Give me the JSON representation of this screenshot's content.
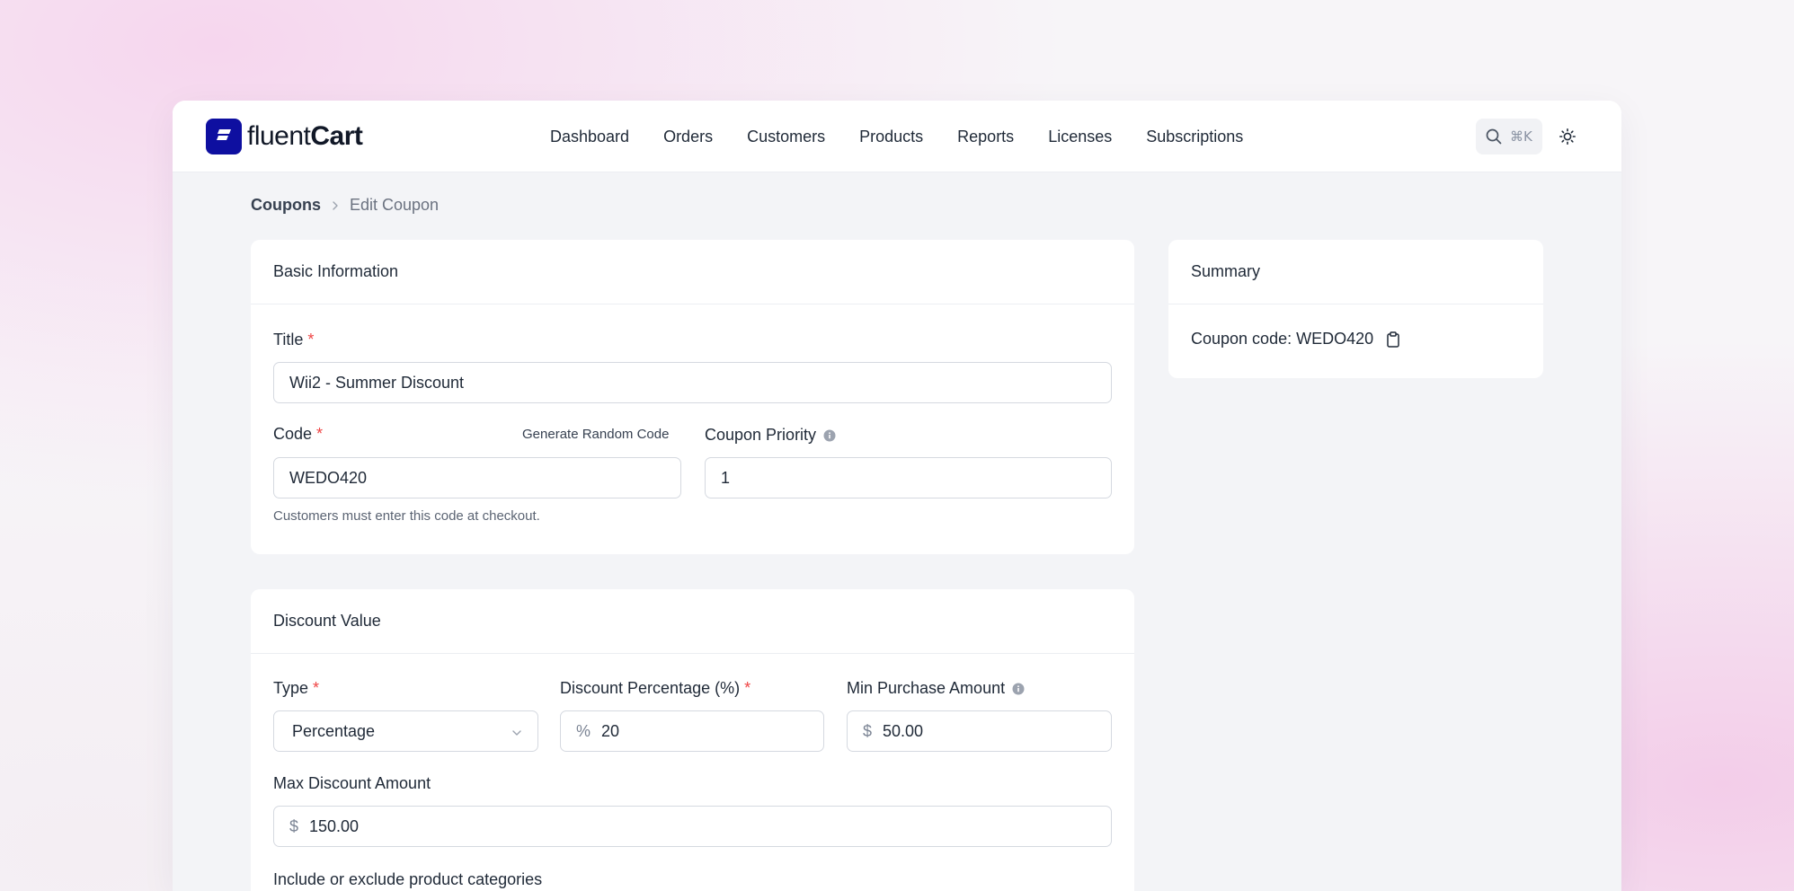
{
  "app": {
    "brand_regular": "fluent",
    "brand_bold": "Cart"
  },
  "nav": {
    "items": [
      "Dashboard",
      "Orders",
      "Customers",
      "Products",
      "Reports",
      "Licenses",
      "Subscriptions"
    ]
  },
  "search": {
    "shortcut": "⌘K",
    "icon": "search-icon"
  },
  "theme": {
    "icon": "sun-icon"
  },
  "breadcrumb": {
    "parent": "Coupons",
    "current": "Edit Coupon"
  },
  "basic_info": {
    "heading": "Basic Information",
    "title_label": "Title",
    "title_value": "Wii2 - Summer Discount",
    "code_label": "Code",
    "generate_link": "Generate Random Code",
    "code_value": "WEDO420",
    "code_help": "Customers must enter this code at checkout.",
    "priority_label": "Coupon Priority",
    "priority_value": "1"
  },
  "discount": {
    "heading": "Discount Value",
    "type_label": "Type",
    "type_value": "Percentage",
    "percentage_label": "Discount Percentage (%)",
    "percentage_prefix": "%",
    "percentage_value": "20",
    "min_label": "Min Purchase Amount",
    "min_prefix": "$",
    "min_value": "50.00",
    "max_label": "Max Discount Amount",
    "max_prefix": "$",
    "max_value": "150.00",
    "categories_label": "Include or exclude product categories"
  },
  "summary": {
    "heading": "Summary",
    "coupon_code_text": "Coupon code: WEDO420"
  },
  "required_marker": "*",
  "colors": {
    "brand": "#0e0fa0",
    "required": "#ef4444"
  }
}
